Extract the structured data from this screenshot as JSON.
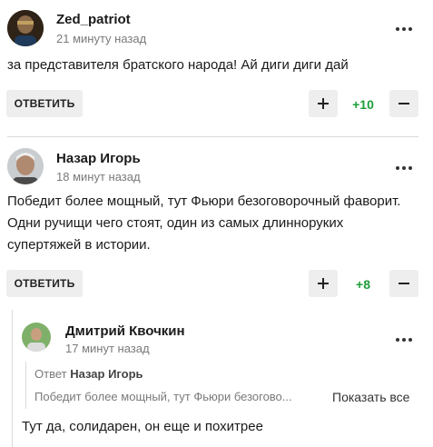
{
  "comments": [
    {
      "author": "Zed_patriot",
      "time": "21 минуту назад",
      "text": "за представителя братского народа! Ай диги диги дай",
      "reply_label": "ОТВЕТИТЬ",
      "score": "+10"
    },
    {
      "author": "Назар Игорь",
      "time": "18 минут назад",
      "text": "Победит более мощный, тут Фьюри безоговорочный фаворит. Одни ручищи чего стоят, один из самых длинноруких супертяжей в истории.",
      "reply_label": "ОТВЕТИТЬ",
      "score": "+8"
    }
  ],
  "reply": {
    "author": "Дмитрий Квочкин",
    "time": "17 минут назад",
    "quote_prefix": "Ответ",
    "quote_author": "Назар Игорь",
    "quote_text": "Победит более мощный, тут Фьюри безогово...",
    "show_all_label": "Показать все",
    "text": "Тут да, солидарен, он еще и похитрее"
  },
  "colors": {
    "score_positive": "#1f9e3a",
    "button_bg": "#eeeeee",
    "separator": "#d9d9d9"
  }
}
